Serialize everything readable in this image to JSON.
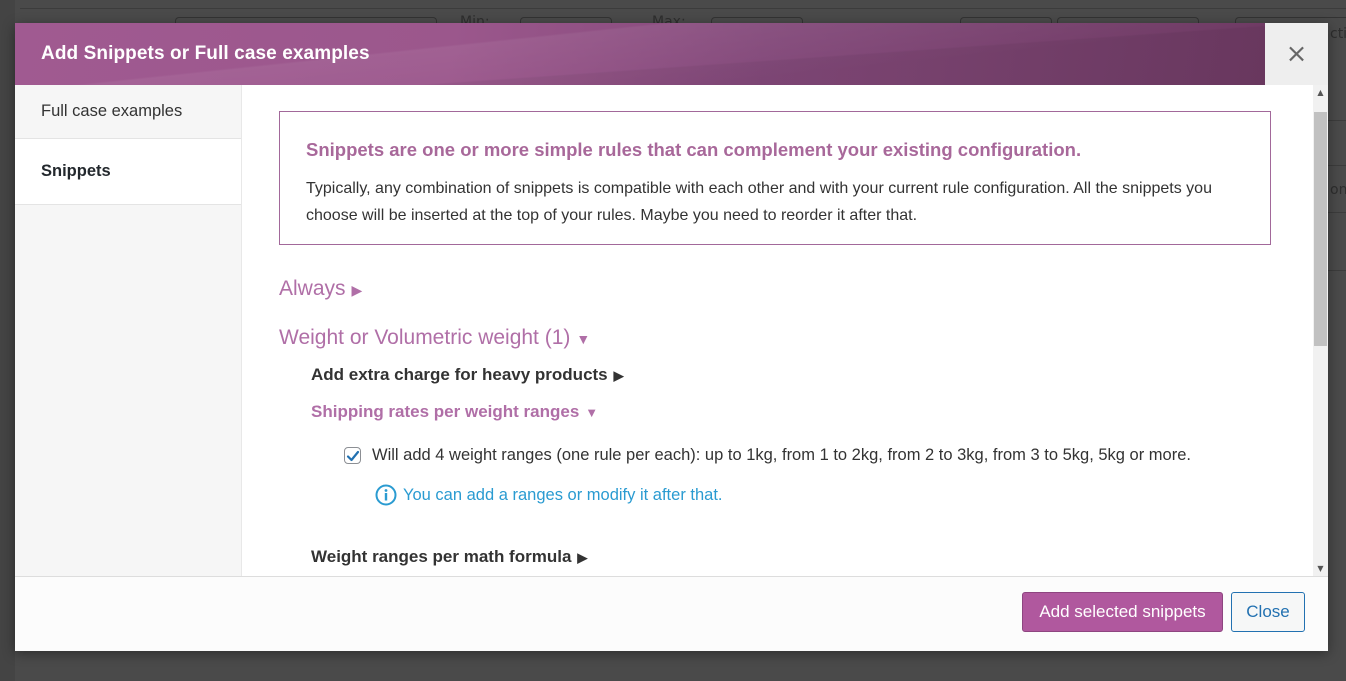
{
  "background": {
    "labels": [
      "Min:",
      "Max:"
    ],
    "right_fragments": [
      "ctio",
      "ons"
    ]
  },
  "modal": {
    "title": "Add Snippets or Full case examples",
    "close_glyph": "×",
    "sidebar": {
      "items": [
        {
          "label": "Full case examples",
          "active": false
        },
        {
          "label": "Snippets",
          "active": true
        }
      ]
    },
    "info_box": {
      "title": "Snippets are one or more simple rules that can complement your existing configuration.",
      "text": "Typically, any combination of snippets is compatible with each other and with your current rule configuration. All the snippets you choose will be inserted at the top of your rules. Maybe you need to reorder it after that."
    },
    "sections": [
      {
        "label": "Always",
        "expanded": false,
        "toggle_glyph": "▶"
      },
      {
        "label": "Weight or Volumetric weight (1)",
        "expanded": true,
        "toggle_glyph": "▼"
      }
    ],
    "subsections": [
      {
        "label": "Add extra charge for heavy products",
        "expanded": false,
        "toggle_glyph": "▶"
      },
      {
        "label": "Shipping rates per weight ranges",
        "expanded": true,
        "toggle_glyph": "▼"
      },
      {
        "label": "Weight ranges per math formula",
        "expanded": false,
        "toggle_glyph": "▶"
      }
    ],
    "option": {
      "checked": true,
      "label": "Will add 4 weight ranges (one rule per each): up to 1kg, from 1 to 2kg, from 2 to 3kg, from 3 to 5kg, 5kg or more.",
      "hint": "You can add a ranges or modify it after that."
    },
    "footer": {
      "primary_label": "Add selected snippets",
      "secondary_label": "Close"
    },
    "colors": {
      "accent": "#b0589e",
      "header_start": "#a05a91",
      "header_end": "#6e3a63",
      "heading_purple": "#b06fa7",
      "hint_blue": "#2a9bd1",
      "secondary_blue": "#2271b1"
    },
    "scrollbar": {
      "up_glyph": "▲",
      "down_glyph": "▼"
    }
  }
}
